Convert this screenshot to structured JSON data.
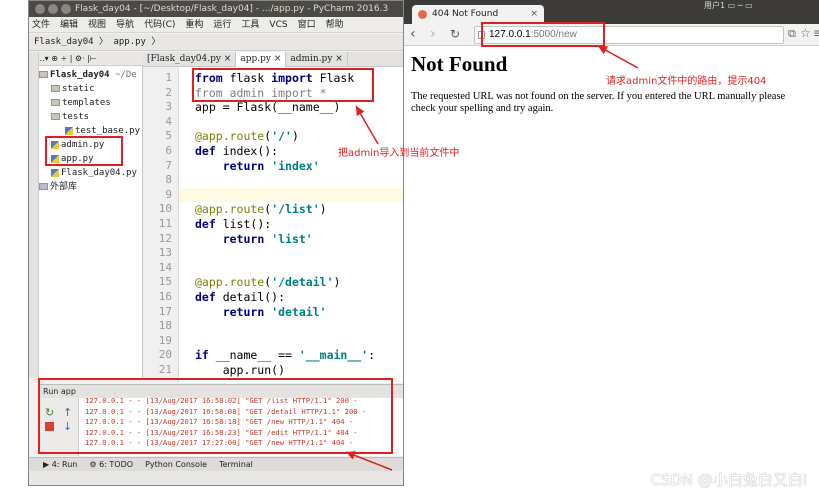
{
  "ide": {
    "title": "Flask_day04 - [~/Desktop/Flask_day04] - .../app.py - PyCharm 2016.3",
    "menu": [
      "文件",
      "编辑",
      "视图",
      "导航",
      "代码(C)",
      "重构",
      "运行",
      "工具",
      "VCS",
      "窗口",
      "帮助"
    ],
    "breadcrumb": "Flask_day04 〉 app.py 〉",
    "project_toolbar": "▢..▾ ⊕ ÷ | ⚙· |⊢",
    "tree": [
      {
        "label": "Flask_day04",
        "suffix": "~/De",
        "type": "root"
      },
      {
        "label": "static",
        "type": "folder"
      },
      {
        "label": "templates",
        "type": "folder"
      },
      {
        "label": "tests",
        "type": "folder"
      },
      {
        "label": "test_base.py",
        "type": "file"
      },
      {
        "label": "admin.py",
        "type": "file"
      },
      {
        "label": "app.py",
        "type": "file"
      },
      {
        "label": "Flask_day04.py",
        "type": "file"
      },
      {
        "label": "外部库",
        "type": "lib"
      }
    ],
    "tabs": [
      "[Flask_day04.py ×",
      "app.py ×",
      "admin.py ×"
    ],
    "line_numbers": [
      "1",
      "2",
      "3",
      "4",
      "5",
      "6",
      "7",
      "8",
      "9",
      "10",
      "11",
      "12",
      "13",
      "14",
      "15",
      "16",
      "17",
      "18",
      "19",
      "20",
      "21"
    ],
    "code": [
      "from flask import Flask",
      "from admin import *",
      "app = Flask(__name__)",
      "",
      "@app.route('/')",
      "def index():",
      "    return 'index'",
      "",
      "",
      "@app.route('/list')",
      "def list():",
      "    return 'list'",
      "",
      "",
      "@app.route('/detail')",
      "def detail():",
      "    return 'detail'",
      "",
      "",
      "if __name__ == '__main__':",
      "    app.run()"
    ],
    "run_header": "Run  app",
    "run_log": [
      "127.0.0.1 - - [13/Aug/2017 16:58:02] \"GET /list HTTP/1.1\" 200 -",
      "127.0.0.1 - - [13/Aug/2017 16:58:08] \"GET /detail HTTP/1.1\" 200 -",
      "127.0.0.1 - - [13/Aug/2017 16:58:18] \"GET /new HTTP/1.1\" 404 -",
      "127.0.0.1 - - [13/Aug/2017 16:58:23] \"GET /edit HTTP/1.1\" 404 -",
      "127.0.0.1 - - [13/Aug/2017 17:27:00] \"GET /new HTTP/1.1\" 404 -"
    ],
    "bottom_tabs": [
      "▶ 4: Run",
      "⚙ 6: TODO",
      "Python Console",
      "Terminal"
    ]
  },
  "browser": {
    "system_bar": "用户1  ▭ ─ ▭",
    "tab_title": "404 Not Found",
    "url_host": "127.0.0.1",
    "url_path": ":5000/new",
    "heading": "Not Found",
    "body": "The requested URL was not found on the server. If you entered the URL manually please check your spelling and try again."
  },
  "annotations": {
    "import_note": "把admin导入到当前文件中",
    "route_note": "请求admin文件中的路由，提示404"
  },
  "watermark": "CSDN @小白兔白又白i",
  "colors": {
    "annotation": "#e02020",
    "keyword": "#000080",
    "string": "#008080",
    "decorator": "#808000"
  }
}
